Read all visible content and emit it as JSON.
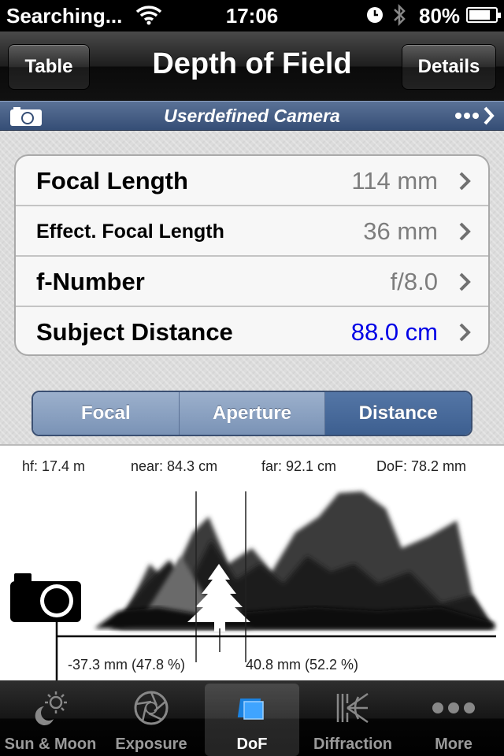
{
  "status_bar": {
    "carrier": "Searching...",
    "time": "17:06",
    "battery": "80%",
    "battery_level": 0.8
  },
  "nav": {
    "left_button": "Table",
    "title": "Depth of Field",
    "right_button": "Details"
  },
  "camera_bar": {
    "name": "Userdefined Camera",
    "more": "•••"
  },
  "settings": [
    {
      "label": "Focal Length",
      "value": "114 mm"
    },
    {
      "label": "Effect. Focal Length",
      "value": "36 mm"
    },
    {
      "label": "f-Number",
      "value": "f/8.0"
    },
    {
      "label": "Subject Distance",
      "value": "88.0 cm"
    }
  ],
  "segmented": {
    "items": [
      "Focal",
      "Aperture",
      "Distance"
    ],
    "selected": "Distance"
  },
  "diagram": {
    "hf": "hf: 17.4 m",
    "near": "near: 84.3 cm",
    "far": "far: 92.1 cm",
    "dof": "DoF: 78.2 mm",
    "front": "-37.3 mm (47.8 %)",
    "back": "40.8 mm (52.2 %)"
  },
  "tabs": [
    {
      "label": "Sun & Moon",
      "icon": "sun-moon-icon"
    },
    {
      "label": "Exposure",
      "icon": "aperture-icon"
    },
    {
      "label": "DoF",
      "icon": "dof-icon"
    },
    {
      "label": "Diffraction",
      "icon": "diffraction-icon"
    },
    {
      "label": "More",
      "icon": "more-dots-icon"
    }
  ],
  "active_tab": "DoF",
  "colors": {
    "subject_distance_value": "#0000e6",
    "segment_active": "#3d5f90",
    "camera_bar": "#354e76"
  }
}
